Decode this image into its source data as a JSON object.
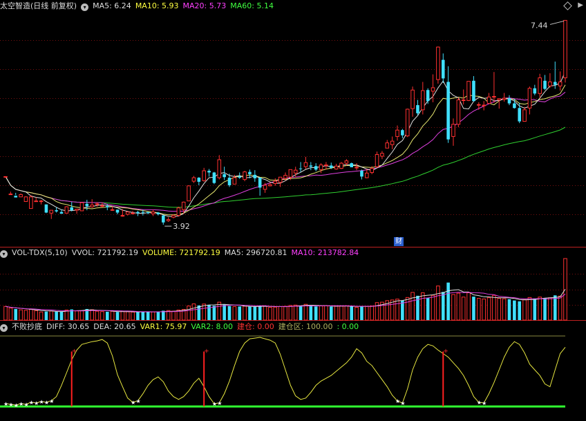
{
  "main": {
    "title": "太空智造(日线 前复权)",
    "ma5": "MA5: 6.24",
    "ma10": "MA10: 5.93",
    "ma20": "MA20: 5.73",
    "ma60": "MA60: 5.14",
    "high_label": "7.44",
    "low_label": "3.92",
    "finance_badge": "财"
  },
  "volume": {
    "title": "VOL-TDX(5,10)",
    "vvol": "VVOL: 721792.19",
    "volume": "VOLUME: 721792.19",
    "ma5": "MA5: 296720.81",
    "ma10": "MA10: 213782.84"
  },
  "indicator": {
    "title": "不败抄底",
    "diff": "DIFF: 30.65",
    "dea": "DEA: 20.65",
    "var1": "VAR1: 75.97",
    "var2": "VAR2: 8.00",
    "jiancang": "建仓: 0.00",
    "jiancangqu": "建仓区: 100.00",
    "extra": ": 0.00"
  },
  "chart_data": [
    {
      "type": "candlestick",
      "ymin": 3.6,
      "ymax": 7.6,
      "candles": [
        [
          4.75,
          4.75,
          4.75,
          4.75
        ],
        [
          4.44,
          4.49,
          4.45,
          4.45
        ],
        [
          4.42,
          4.47,
          4.43,
          4.39
        ],
        [
          4.4,
          4.46,
          4.4,
          4.44
        ],
        [
          4.32,
          4.41,
          4.32,
          4.4
        ],
        [
          4.2,
          4.43,
          4.2,
          4.4
        ],
        [
          4.33,
          4.39,
          4.32,
          4.33
        ],
        [
          4.32,
          4.35,
          4.27,
          4.33
        ],
        [
          4.27,
          4.27,
          4.12,
          4.13
        ],
        [
          4.12,
          4.17,
          4.02,
          4.17
        ],
        [
          4.17,
          4.22,
          4.13,
          4.15
        ],
        [
          4.14,
          4.18,
          4.11,
          4.11
        ],
        [
          4.12,
          4.24,
          4.11,
          4.23
        ],
        [
          4.22,
          4.31,
          4.15,
          4.17
        ],
        [
          4.17,
          4.19,
          4.11,
          4.19
        ],
        [
          4.16,
          4.31,
          4.16,
          4.3
        ],
        [
          4.28,
          4.35,
          4.17,
          4.24
        ],
        [
          4.23,
          4.36,
          4.21,
          4.26
        ],
        [
          4.27,
          4.31,
          4.23,
          4.28
        ],
        [
          4.25,
          4.3,
          4.22,
          4.25
        ],
        [
          4.24,
          4.28,
          4.17,
          4.22
        ],
        [
          4.18,
          4.24,
          4.16,
          4.18
        ],
        [
          4.18,
          4.18,
          4.1,
          4.13
        ],
        [
          4.08,
          4.19,
          4.06,
          4.08
        ],
        [
          4.1,
          4.15,
          4.08,
          4.14
        ],
        [
          4.12,
          4.16,
          4.1,
          4.12
        ],
        [
          4.14,
          4.16,
          4.07,
          4.12
        ],
        [
          4.14,
          4.18,
          4.08,
          4.13
        ],
        [
          4.14,
          4.14,
          4.1,
          4.12
        ],
        [
          4.11,
          4.18,
          4.07,
          4.14
        ],
        [
          4.13,
          4.14,
          4.08,
          4.1
        ],
        [
          4.08,
          4.09,
          3.92,
          3.96
        ],
        [
          3.99,
          4.05,
          3.97,
          4.01
        ],
        [
          4.05,
          4.1,
          4.03,
          4.08
        ],
        [
          4.08,
          4.23,
          4.06,
          4.21
        ],
        [
          4.18,
          4.32,
          4.11,
          4.31
        ],
        [
          4.33,
          4.6,
          4.33,
          4.59
        ],
        [
          4.67,
          4.76,
          4.64,
          4.73
        ],
        [
          4.73,
          4.74,
          4.6,
          4.66
        ],
        [
          4.68,
          4.9,
          4.66,
          4.85
        ],
        [
          4.85,
          4.88,
          4.75,
          4.82
        ],
        [
          4.82,
          4.83,
          4.62,
          4.64
        ],
        [
          4.73,
          5.12,
          4.7,
          5.04
        ],
        [
          4.79,
          4.92,
          4.69,
          4.74
        ],
        [
          4.73,
          4.8,
          4.57,
          4.6
        ],
        [
          4.62,
          4.78,
          4.62,
          4.73
        ],
        [
          4.75,
          4.82,
          4.71,
          4.73
        ],
        [
          4.7,
          4.85,
          4.67,
          4.83
        ],
        [
          4.83,
          4.87,
          4.72,
          4.79
        ],
        [
          4.78,
          4.86,
          4.66,
          4.72
        ],
        [
          4.73,
          4.74,
          4.42,
          4.56
        ],
        [
          4.53,
          4.64,
          4.47,
          4.6
        ],
        [
          4.59,
          4.65,
          4.58,
          4.61
        ],
        [
          4.63,
          4.72,
          4.59,
          4.67
        ],
        [
          4.65,
          4.74,
          4.57,
          4.74
        ],
        [
          4.72,
          4.82,
          4.68,
          4.77
        ],
        [
          4.74,
          4.87,
          4.69,
          4.87
        ],
        [
          4.81,
          4.92,
          4.74,
          4.86
        ],
        [
          4.89,
          5.0,
          4.83,
          4.88
        ],
        [
          4.92,
          5.09,
          4.88,
          4.99
        ],
        [
          4.94,
          5.0,
          4.86,
          4.92
        ],
        [
          4.93,
          4.98,
          4.84,
          4.87
        ],
        [
          4.87,
          4.98,
          4.81,
          4.95
        ],
        [
          4.94,
          5.0,
          4.87,
          4.95
        ],
        [
          4.94,
          4.99,
          4.88,
          4.9
        ],
        [
          4.88,
          4.97,
          4.87,
          4.93
        ],
        [
          4.89,
          5.0,
          4.88,
          4.98
        ],
        [
          4.98,
          5.05,
          4.94,
          5.02
        ],
        [
          4.98,
          4.99,
          4.91,
          4.91
        ],
        [
          4.91,
          4.98,
          4.86,
          4.91
        ],
        [
          4.85,
          4.87,
          4.7,
          4.75
        ],
        [
          4.73,
          4.88,
          4.72,
          4.81
        ],
        [
          4.82,
          4.93,
          4.79,
          4.89
        ],
        [
          4.92,
          5.18,
          4.9,
          5.13
        ],
        [
          5.1,
          5.19,
          5.05,
          5.15
        ],
        [
          5.24,
          5.38,
          5.24,
          5.33
        ],
        [
          5.3,
          5.44,
          5.22,
          5.36
        ],
        [
          5.44,
          5.63,
          5.37,
          5.55
        ],
        [
          5.55,
          5.57,
          5.41,
          5.46
        ],
        [
          5.45,
          5.92,
          5.43,
          5.91
        ],
        [
          5.92,
          6.3,
          5.78,
          6.24
        ],
        [
          5.98,
          6.07,
          5.81,
          5.84
        ],
        [
          5.9,
          6.38,
          5.82,
          6.23
        ],
        [
          6.24,
          6.27,
          6.0,
          6.05
        ],
        [
          6.22,
          6.51,
          6.03,
          6.28
        ],
        [
          6.42,
          6.99,
          6.35,
          6.98
        ],
        [
          6.76,
          6.87,
          6.36,
          6.44
        ],
        [
          6.38,
          6.65,
          5.33,
          5.39
        ],
        [
          5.44,
          5.75,
          5.28,
          5.65
        ],
        [
          5.65,
          6.11,
          5.6,
          6.07
        ],
        [
          6.06,
          6.25,
          5.99,
          6.07
        ],
        [
          6.06,
          6.39,
          6.05,
          6.39
        ],
        [
          6.4,
          6.48,
          6.04,
          6.05
        ],
        [
          5.99,
          6.03,
          5.9,
          5.99
        ],
        [
          5.97,
          6.05,
          5.89,
          5.98
        ],
        [
          6.01,
          6.19,
          6.01,
          6.12
        ],
        [
          6.12,
          6.55,
          6.02,
          6.13
        ],
        [
          6.07,
          6.1,
          5.92,
          6.09
        ],
        [
          6.08,
          6.19,
          6.04,
          6.1
        ],
        [
          6.1,
          6.15,
          5.98,
          6.01
        ],
        [
          6.01,
          6.09,
          5.92,
          5.93
        ],
        [
          5.93,
          6.02,
          5.67,
          5.7
        ],
        [
          5.7,
          5.95,
          5.7,
          5.9
        ],
        [
          5.93,
          6.3,
          5.82,
          6.27
        ],
        [
          6.27,
          6.33,
          6.15,
          6.18
        ],
        [
          6.18,
          6.52,
          6.1,
          6.45
        ],
        [
          6.4,
          6.5,
          6.24,
          6.26
        ],
        [
          6.31,
          6.53,
          6.28,
          6.38
        ],
        [
          6.38,
          6.73,
          6.26,
          6.33
        ],
        [
          6.31,
          6.56,
          6.23,
          6.38
        ],
        [
          6.45,
          7.44,
          6.37,
          7.44
        ]
      ]
    },
    {
      "type": "bar",
      "name": "volume",
      "values": [
        160000,
        140000,
        130000,
        120000,
        115000,
        125000,
        110000,
        95000,
        100000,
        105000,
        98000,
        102000,
        118000,
        125000,
        108000,
        112000,
        130000,
        122000,
        104000,
        100000,
        98000,
        103000,
        95000,
        102000,
        97000,
        94000,
        92000,
        99000,
        101000,
        96000,
        93000,
        110000,
        112000,
        105000,
        118000,
        125000,
        165000,
        190000,
        172000,
        188000,
        174000,
        168000,
        210000,
        180000,
        165000,
        158000,
        160000,
        162000,
        158000,
        154000,
        170000,
        166000,
        150000,
        152000,
        158000,
        162000,
        172000,
        176000,
        170000,
        185000,
        168000,
        160000,
        166000,
        170000,
        158000,
        162000,
        164000,
        168000,
        158000,
        150000,
        165000,
        160000,
        166000,
        205000,
        210000,
        228000,
        236000,
        246000,
        230000,
        265000,
        325000,
        285000,
        320000,
        260000,
        290000,
        400000,
        330000,
        440000,
        300000,
        315000,
        270000,
        320000,
        275000,
        255000,
        248000,
        262000,
        290000,
        255000,
        250000,
        245000,
        230000,
        220000,
        240000,
        265000,
        252000,
        270000,
        258000,
        262000,
        290000,
        282000,
        721792
      ]
    },
    {
      "type": "line",
      "name": "DIFF",
      "values": [
        4,
        3,
        2,
        4,
        3,
        6,
        5,
        7,
        6,
        8,
        14,
        30,
        48,
        66,
        80,
        88,
        90,
        92,
        93,
        95,
        90,
        72,
        45,
        28,
        12,
        6,
        8,
        18,
        30,
        38,
        42,
        35,
        22,
        14,
        10,
        14,
        22,
        33,
        40,
        28,
        14,
        4,
        5,
        18,
        36,
        58,
        78,
        90,
        96,
        97,
        98,
        96,
        94,
        90,
        74,
        52,
        30,
        15,
        10,
        12,
        20,
        30,
        36,
        40,
        44,
        50,
        56,
        62,
        70,
        82,
        76,
        64,
        58,
        48,
        38,
        28,
        16,
        8,
        5,
        25,
        52,
        70,
        82,
        88,
        86,
        80,
        75,
        70,
        62,
        54,
        44,
        30,
        14,
        6,
        5,
        18,
        34,
        52,
        70,
        84,
        92,
        88,
        76,
        60,
        52,
        44,
        32,
        28,
        52,
        75,
        84,
        78,
        52,
        40
      ]
    }
  ]
}
